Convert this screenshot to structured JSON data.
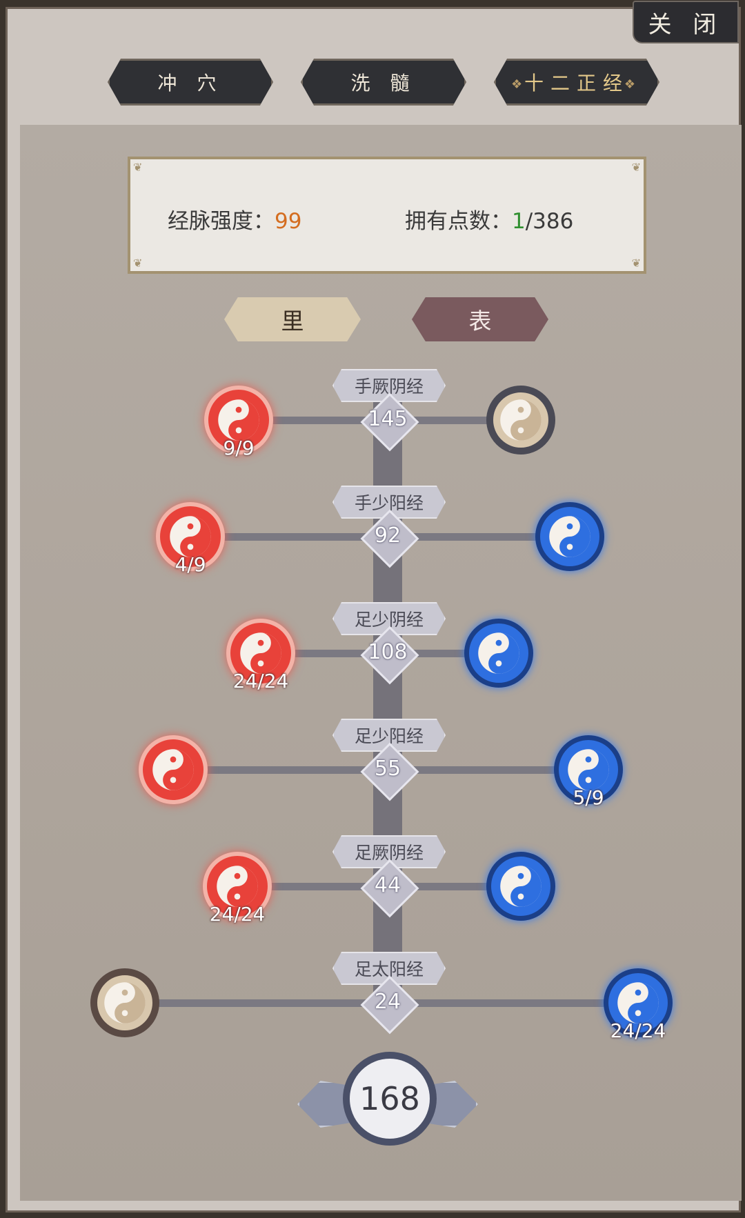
{
  "header": {
    "close_label": "关 闭",
    "tabs": [
      {
        "label": "冲 穴"
      },
      {
        "label": "洗 髓"
      },
      {
        "label": "十二正经",
        "active": true
      }
    ]
  },
  "info": {
    "strength_label": "经脉强度：",
    "strength_value": "99",
    "points_label": "拥有点数：",
    "points_current": "1",
    "points_total": "/386"
  },
  "side_tabs": {
    "li": "里",
    "biao": "表",
    "selected": "表"
  },
  "meridians": [
    {
      "name": "手厥阴经",
      "value": "145",
      "left": {
        "color": "red",
        "count": "9/9"
      },
      "right": {
        "color": "gray",
        "count": ""
      }
    },
    {
      "name": "手少阳经",
      "value": "92",
      "left": {
        "color": "red",
        "count": "4/9"
      },
      "right": {
        "color": "blue",
        "count": ""
      }
    },
    {
      "name": "足少阴经",
      "value": "108",
      "left": {
        "color": "red",
        "count": "24/24"
      },
      "right": {
        "color": "blue",
        "count": ""
      }
    },
    {
      "name": "足少阳经",
      "value": "55",
      "left": {
        "color": "red",
        "count": ""
      },
      "right": {
        "color": "blue",
        "count": "5/9"
      }
    },
    {
      "name": "足厥阴经",
      "value": "44",
      "left": {
        "color": "red",
        "count": "24/24"
      },
      "right": {
        "color": "blue",
        "count": ""
      }
    },
    {
      "name": "足太阳经",
      "value": "24",
      "left": {
        "color": "brown",
        "count": ""
      },
      "right": {
        "color": "blue",
        "count": "24/24"
      }
    }
  ],
  "total": "168",
  "colors": {
    "accent_orange": "#d46d20",
    "accent_green": "#2f8f2f",
    "node_red": "#e8423a",
    "node_blue": "#2e6fe0"
  }
}
